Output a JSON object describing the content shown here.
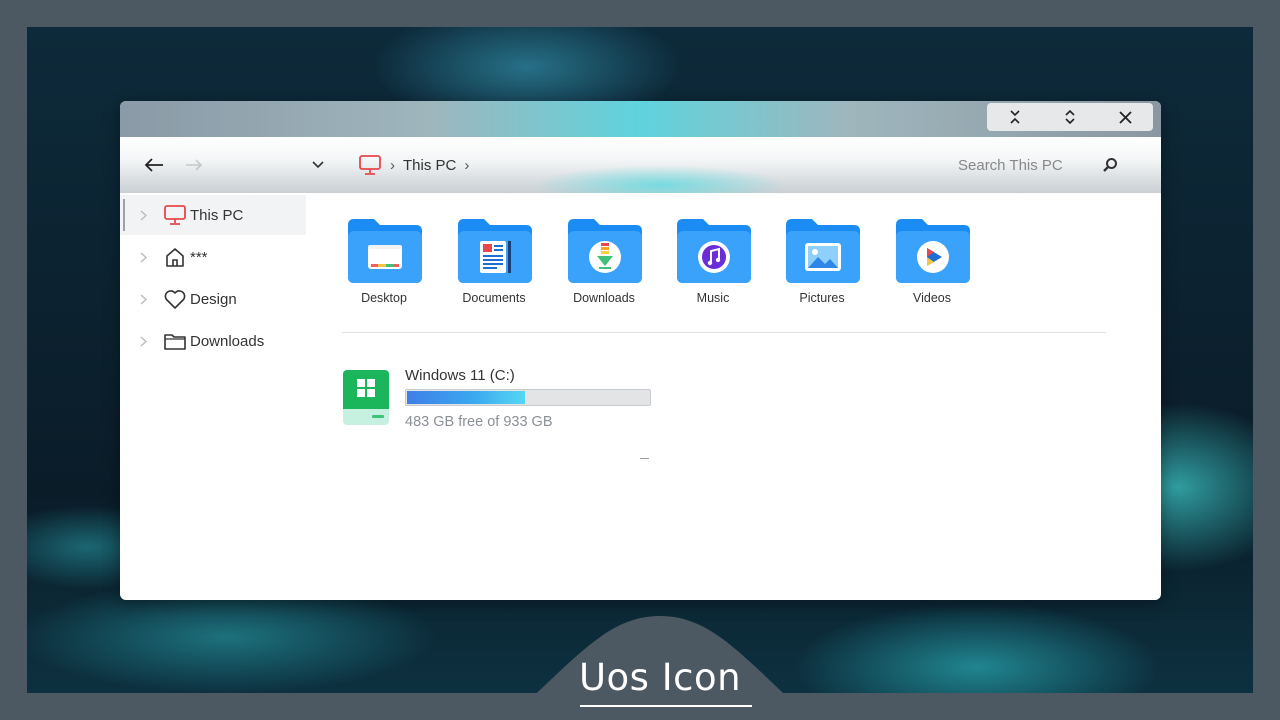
{
  "window": {
    "controls": [
      "⌄",
      "⌃",
      "✕"
    ]
  },
  "toolbar": {
    "breadcrumb": [
      "This PC"
    ],
    "search_placeholder": "Search This PC"
  },
  "sidebar": {
    "items": [
      {
        "label": "This PC",
        "icon": "monitor-icon",
        "active": true
      },
      {
        "label": "***",
        "icon": "home-icon"
      },
      {
        "label": "Design",
        "icon": "heart-icon"
      },
      {
        "label": "Downloads",
        "icon": "folder-outline-icon"
      }
    ]
  },
  "folders": [
    {
      "label": "Desktop",
      "icon": "desktop-folder-icon"
    },
    {
      "label": "Documents",
      "icon": "documents-folder-icon"
    },
    {
      "label": "Downloads",
      "icon": "downloads-folder-icon"
    },
    {
      "label": "Music",
      "icon": "music-folder-icon"
    },
    {
      "label": "Pictures",
      "icon": "pictures-folder-icon"
    },
    {
      "label": "Videos",
      "icon": "videos-folder-icon"
    }
  ],
  "drive": {
    "name": "Windows 11 (C:)",
    "free_text": "483 GB free of 933 GB",
    "used_fraction": 0.4823
  },
  "banner": {
    "text": "Uos Icon"
  },
  "colors": {
    "accent": "#e5484d",
    "folder_blue": "#1c8cf5",
    "drive_green": "#1bb55c"
  }
}
